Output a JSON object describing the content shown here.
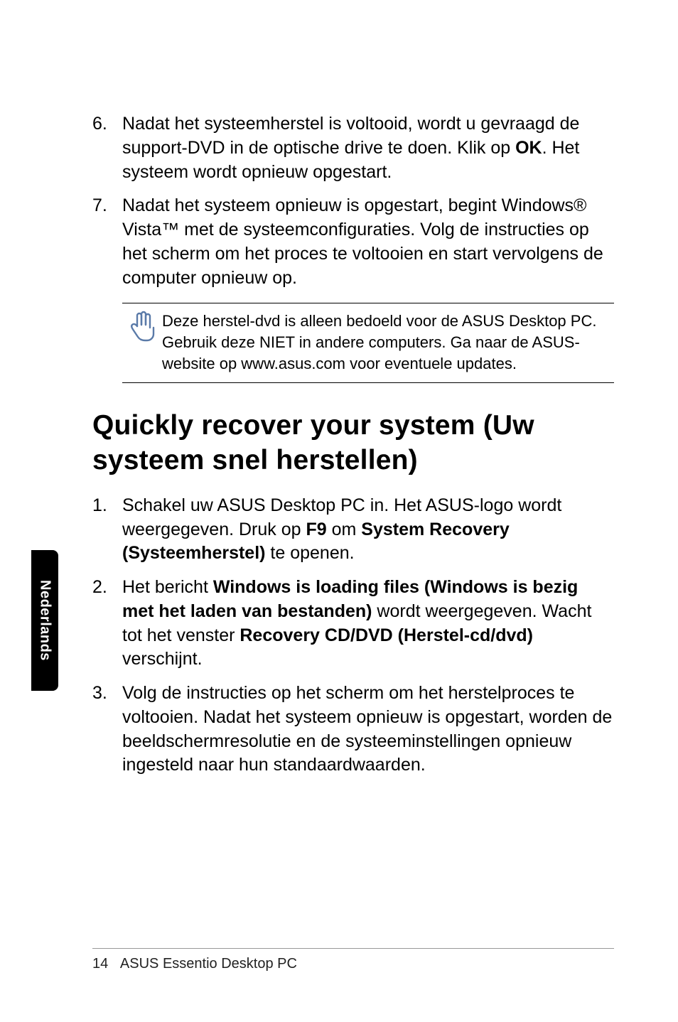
{
  "list_top": [
    {
      "num": "6.",
      "html": "Nadat het systeemherstel is voltooid, wordt u gevraagd de support-DVD in de optische drive te doen. Klik op <b>OK</b>. Het systeem wordt opnieuw opgestart."
    },
    {
      "num": "7.",
      "html": "Nadat het systeem opnieuw is opgestart, begint Windows® Vista™ met de systeemconfiguraties. Volg de instructies op het scherm om het proces te voltooien en start vervolgens de computer opnieuw op."
    }
  ],
  "note": "Deze herstel-dvd is alleen bedoeld voor de ASUS Desktop PC. Gebruik deze NIET in andere computers. Ga naar de ASUS-website op www.asus.com voor eventuele updates.",
  "heading": "Quickly recover your system (Uw systeem snel herstellen)",
  "list_main": [
    {
      "num": "1.",
      "html": "Schakel uw ASUS Desktop PC in. Het ASUS-logo wordt weergegeven. Druk op <b>F9</b> om <b>System Recovery (Systeemherstel)</b> te openen."
    },
    {
      "num": "2.",
      "html": "Het bericht <b>Windows is loading files (Windows is bezig met het laden van bestanden)</b> wordt weergegeven. Wacht tot het venster <b>Recovery CD/DVD (Herstel-cd/dvd)</b> verschijnt."
    },
    {
      "num": "3.",
      "html": "Volg de instructies op het scherm om het herstelproces te voltooien. Nadat het systeem opnieuw is opgestart, worden de beeldschermresolutie en de systeeminstellingen opnieuw ingesteld naar hun standaardwaarden."
    }
  ],
  "sidetab": "Nederlands",
  "footer_page": "14",
  "footer_title": "ASUS Essentio Desktop PC"
}
